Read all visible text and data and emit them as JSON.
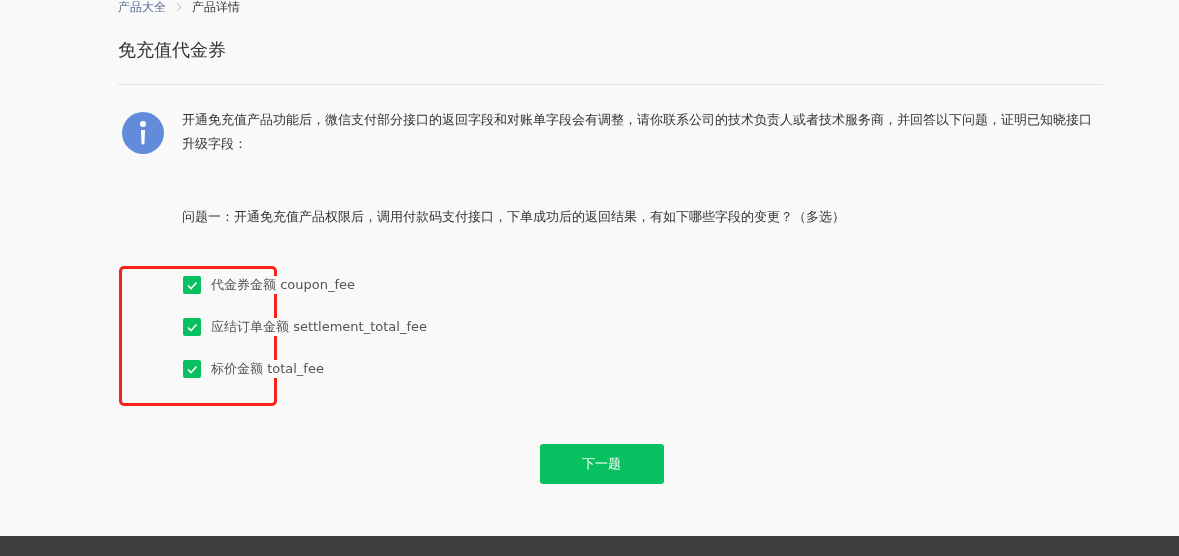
{
  "breadcrumb": [
    {
      "label": "产品大全"
    },
    {
      "label": "产品详情"
    }
  ],
  "title": "免充值代金券",
  "notice": "开通免充值产品功能后，微信支付部分接口的返回字段和对账单字段会有调整，请你联系公司的技术负责人或者技术服务商，并回答以下问题，证明已知晓接口升级字段：",
  "question": "问题一：开通免充值产品权限后，调用付款码支付接口，下单成功后的返回结果，有如下哪些字段的变更？（多选）",
  "options": [
    {
      "label": "代金券金额 coupon_fee",
      "checked": true
    },
    {
      "label": "应结订单金额 settlement_total_fee",
      "checked": true
    },
    {
      "label": "标价金额 total_fee",
      "checked": true
    }
  ],
  "next_button": "下一题"
}
